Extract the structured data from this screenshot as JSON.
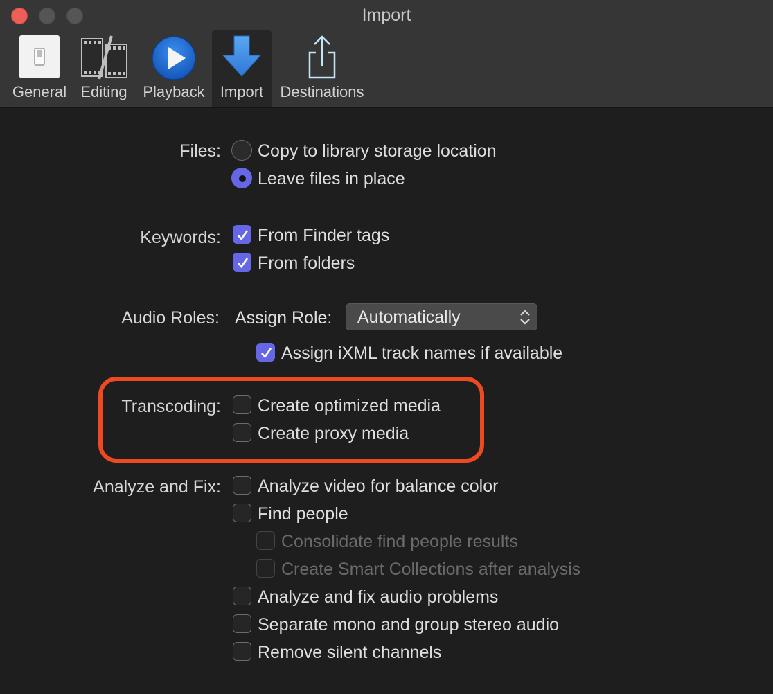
{
  "window": {
    "title": "Import"
  },
  "toolbar": {
    "items": [
      {
        "label": "General",
        "icon": "general-switch-icon"
      },
      {
        "label": "Editing",
        "icon": "film-edit-icon"
      },
      {
        "label": "Playback",
        "icon": "play-circle-icon"
      },
      {
        "label": "Import",
        "icon": "import-arrow-icon",
        "selected": true
      },
      {
        "label": "Destinations",
        "icon": "share-icon"
      }
    ]
  },
  "files": {
    "label": "Files:",
    "options": [
      {
        "label": "Copy to library storage location",
        "selected": false
      },
      {
        "label": "Leave files in place",
        "selected": true
      }
    ]
  },
  "keywords": {
    "label": "Keywords:",
    "options": [
      {
        "label": "From Finder tags",
        "checked": true
      },
      {
        "label": "From folders",
        "checked": true
      }
    ]
  },
  "audio_roles": {
    "label": "Audio Roles:",
    "assign_role_label": "Assign Role:",
    "assign_role_value": "Automatically",
    "ixml": {
      "label": "Assign iXML track names if available",
      "checked": true
    }
  },
  "transcoding": {
    "label": "Transcoding:",
    "options": [
      {
        "label": "Create optimized media",
        "checked": false
      },
      {
        "label": "Create proxy media",
        "checked": false
      }
    ]
  },
  "analyze": {
    "label": "Analyze and Fix:",
    "options": [
      {
        "label": "Analyze video for balance color",
        "checked": false
      },
      {
        "label": "Find people",
        "checked": false
      },
      {
        "label": "Consolidate find people results",
        "checked": false,
        "disabled": true
      },
      {
        "label": "Create Smart Collections after analysis",
        "checked": false,
        "disabled": true
      },
      {
        "label": "Analyze and fix audio problems",
        "checked": false
      },
      {
        "label": "Separate mono and group stereo audio",
        "checked": false
      },
      {
        "label": "Remove silent channels",
        "checked": false
      }
    ]
  },
  "colors": {
    "accent": "#6667e6",
    "highlight": "#ee4a21",
    "background": "#1e1e1e"
  }
}
